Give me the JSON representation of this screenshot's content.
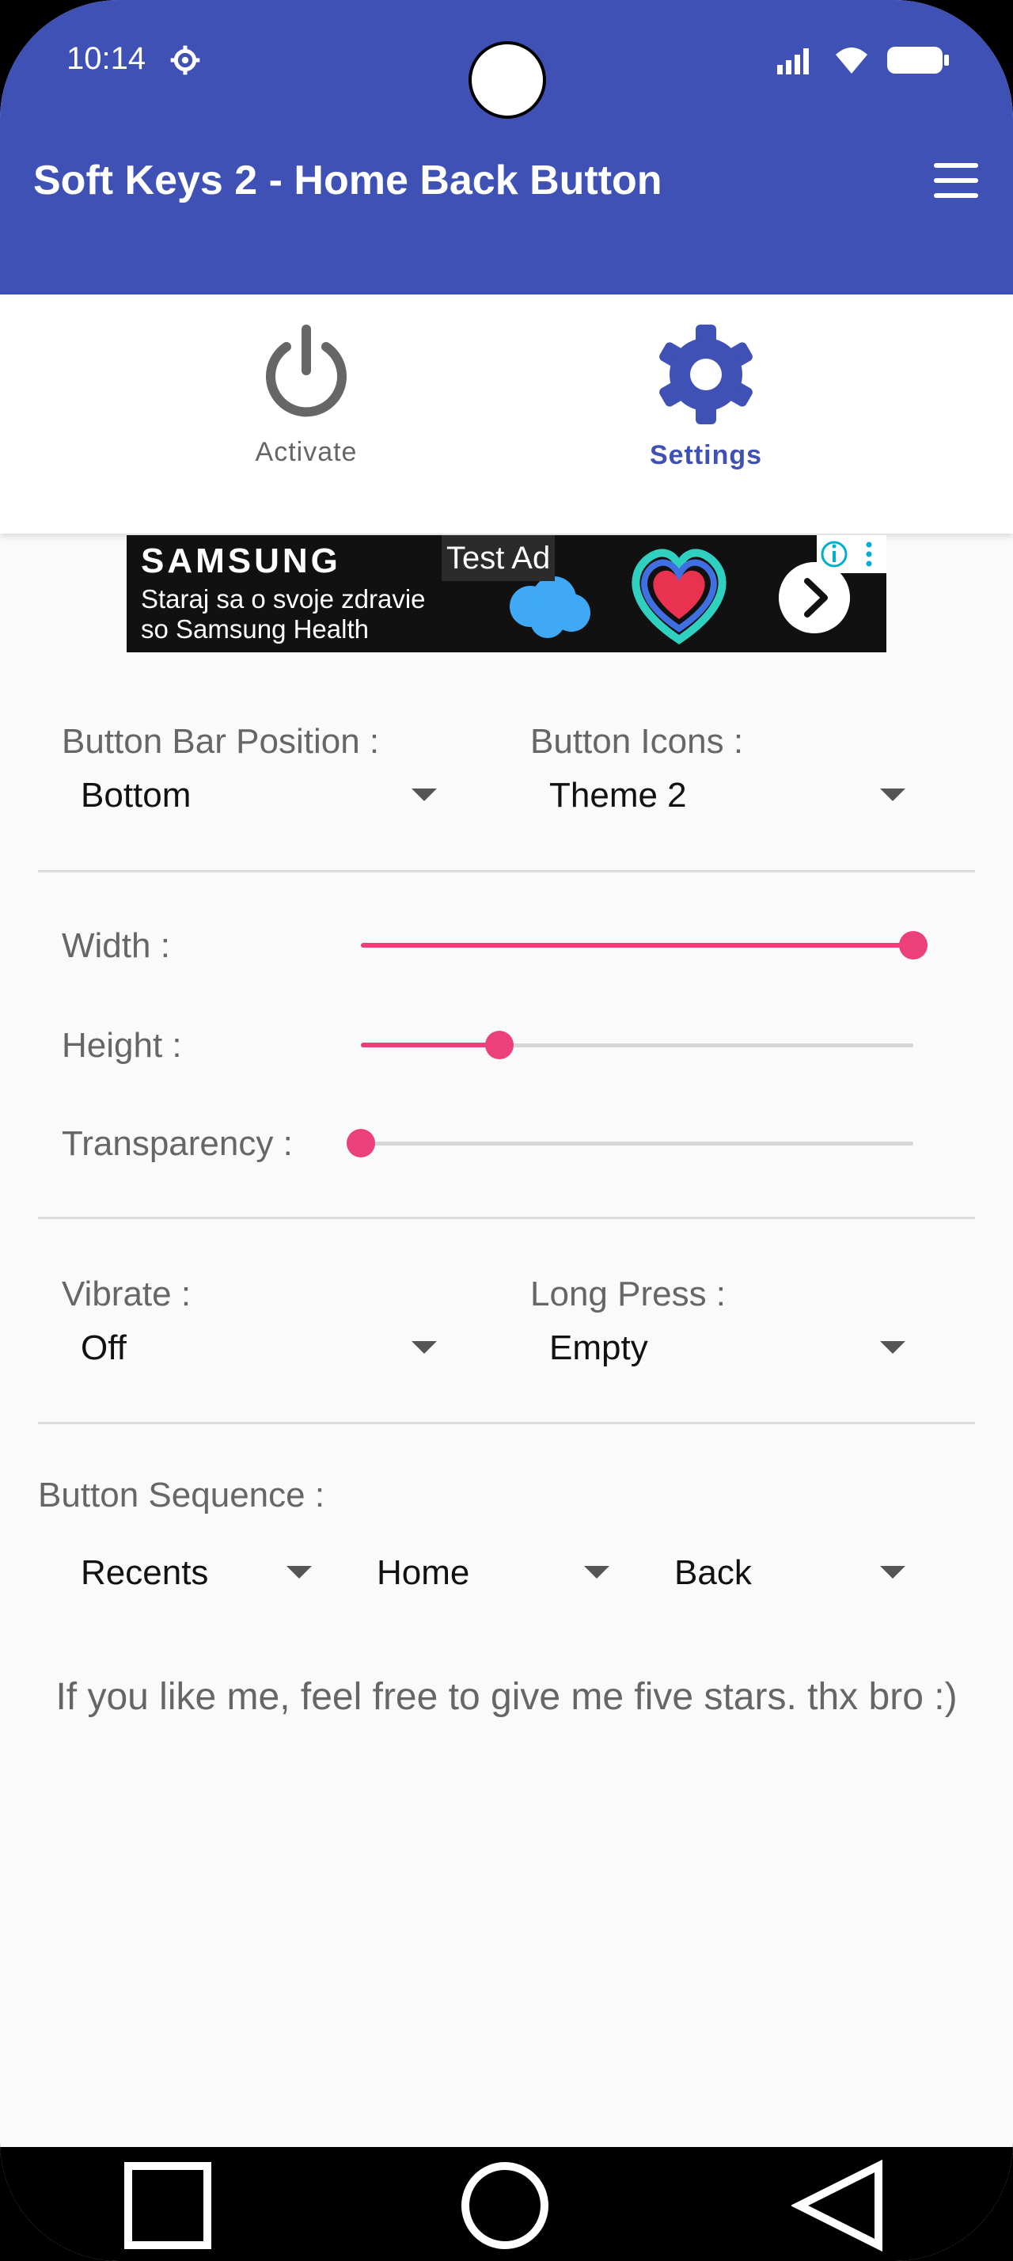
{
  "status_bar": {
    "time": "10:14",
    "icons": [
      "settings-gear-icon",
      "cellular-signal-icon",
      "wifi-icon",
      "battery-icon"
    ]
  },
  "app_bar": {
    "title": "Soft Keys 2 - Home Back Button",
    "menu_icon": "hamburger-menu-icon",
    "color": "#3f51b5"
  },
  "tabs": [
    {
      "label": "Activate",
      "icon": "power-icon",
      "selected": false
    },
    {
      "label": "Settings",
      "icon": "gear-icon",
      "selected": true
    }
  ],
  "ad": {
    "brand": "SAMSUNG",
    "line1": "Staraj sa o svoje zdravie",
    "line2": "so Samsung Health",
    "badge": "Test Ad"
  },
  "settings": {
    "button_bar_position": {
      "label": "Button Bar Position :",
      "value": "Bottom"
    },
    "button_icons": {
      "label": "Button Icons :",
      "value": "Theme 2"
    },
    "width": {
      "label": "Width :",
      "level": 1.0
    },
    "height": {
      "label": "Height :",
      "level": 0.25
    },
    "transparency": {
      "label": "Transparency :",
      "level": 0.0
    },
    "vibrate": {
      "label": "Vibrate :",
      "value": "Off"
    },
    "long_press": {
      "label": "Long Press :",
      "value": "Empty"
    },
    "button_sequence": {
      "label": "Button Sequence :",
      "items": [
        "Recents",
        "Home",
        "Back"
      ]
    }
  },
  "footnote": "If you like me, feel free to give me five stars. thx bro :)",
  "accent_color": "#ec407a",
  "nav_bar": {
    "buttons": [
      "recents-square-icon",
      "home-circle-icon",
      "back-triangle-icon"
    ]
  }
}
